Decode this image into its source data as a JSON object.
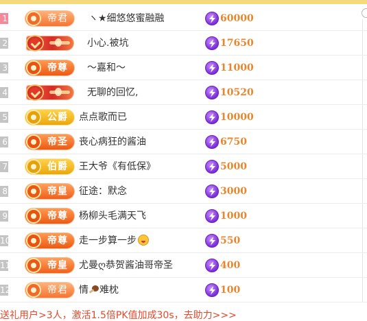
{
  "accent_colors": {
    "rank_top": "#f3899b",
    "rank_other": "#c4c4c4",
    "amount": "#e8862d",
    "coin": "#8a3ee6",
    "footer_text": "#e0492c"
  },
  "currency_icon": "purple-lightning-coin-icon",
  "leaderboard": [
    {
      "rank": "1",
      "badge_text": "帝君",
      "tier": "dijun",
      "username": "ヽ★细悠悠蜜融融",
      "amount": "60000"
    },
    {
      "rank": "2",
      "badge_text": "",
      "tier": "ornate",
      "username": "小心.被坑",
      "amount": "17650"
    },
    {
      "rank": "3",
      "badge_text": "帝尊",
      "tier": "dizun",
      "username": "～嘉和～",
      "amount": "11000"
    },
    {
      "rank": "4",
      "badge_text": "",
      "tier": "ornate",
      "username": "无聊的回忆,",
      "amount": "10520"
    },
    {
      "rank": "5",
      "badge_text": "公爵",
      "tier": "gongjue",
      "username": "点点歌而已",
      "amount": "10000"
    },
    {
      "rank": "6",
      "badge_text": "帝圣",
      "tier": "disheng",
      "username": "丧心病狂的酱油",
      "amount": "6750"
    },
    {
      "rank": "7",
      "badge_text": "伯爵",
      "tier": "bojue",
      "username": "王大爷《有低保》",
      "amount": "5000"
    },
    {
      "rank": "8",
      "badge_text": "帝皇",
      "tier": "dihuang",
      "username": "征途：默念",
      "amount": "3000"
    },
    {
      "rank": "9",
      "badge_text": "帝尊",
      "tier": "dizun",
      "username": "杨柳头毛满天飞",
      "amount": "1000"
    },
    {
      "rank": "10",
      "badge_text": "帝尊",
      "tier": "dizun",
      "username": "走一步算一步",
      "amount": "550",
      "emoji": "grinning-face-icon"
    },
    {
      "rank": "11",
      "badge_text": "帝皇",
      "tier": "dihuang",
      "username": "尤曼ღ恭贺酱油哥帝圣",
      "amount": "400"
    },
    {
      "rank": "12",
      "badge_text": "帝君",
      "tier": "dijun",
      "username_pre": "情",
      "username_post": "难枕",
      "amount": "100",
      "emoji": "drumstick-icon"
    }
  ],
  "footer": {
    "text": "送礼用户>3人，激活1.5倍PK值加成30s，去助力>>>"
  }
}
